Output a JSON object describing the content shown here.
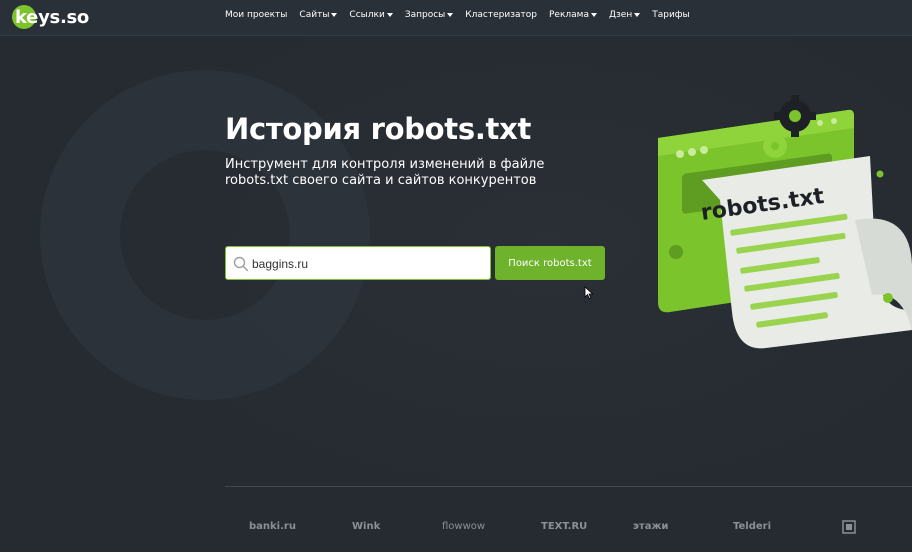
{
  "brand": {
    "logo_text": "keys.so",
    "accent": "#7bc42c"
  },
  "nav": {
    "items": [
      {
        "label": "Мои проекты",
        "dropdown": false
      },
      {
        "label": "Сайты",
        "dropdown": true
      },
      {
        "label": "Ссылки",
        "dropdown": true
      },
      {
        "label": "Запросы",
        "dropdown": true
      },
      {
        "label": "Кластеризатор",
        "dropdown": false
      },
      {
        "label": "Реклама",
        "dropdown": true
      },
      {
        "label": "Дзен",
        "dropdown": true
      },
      {
        "label": "Тарифы",
        "dropdown": false
      }
    ]
  },
  "hero": {
    "title": "История robots.txt",
    "subtitle": "Инструмент для контроля изменений в файле robots.txt своего сайта и сайтов конкурентов"
  },
  "search": {
    "value": "baggins.ru",
    "button_label": "Поиск robots.txt"
  },
  "illustration": {
    "doc_label": "robots.txt"
  },
  "partners": [
    "banki.ru",
    "Wink",
    "flowwow",
    "TEXT.RU",
    "этажи",
    "Telderi"
  ],
  "colors": {
    "background": "#262b31",
    "header": "#2a3038",
    "button": "#6fb22c"
  }
}
